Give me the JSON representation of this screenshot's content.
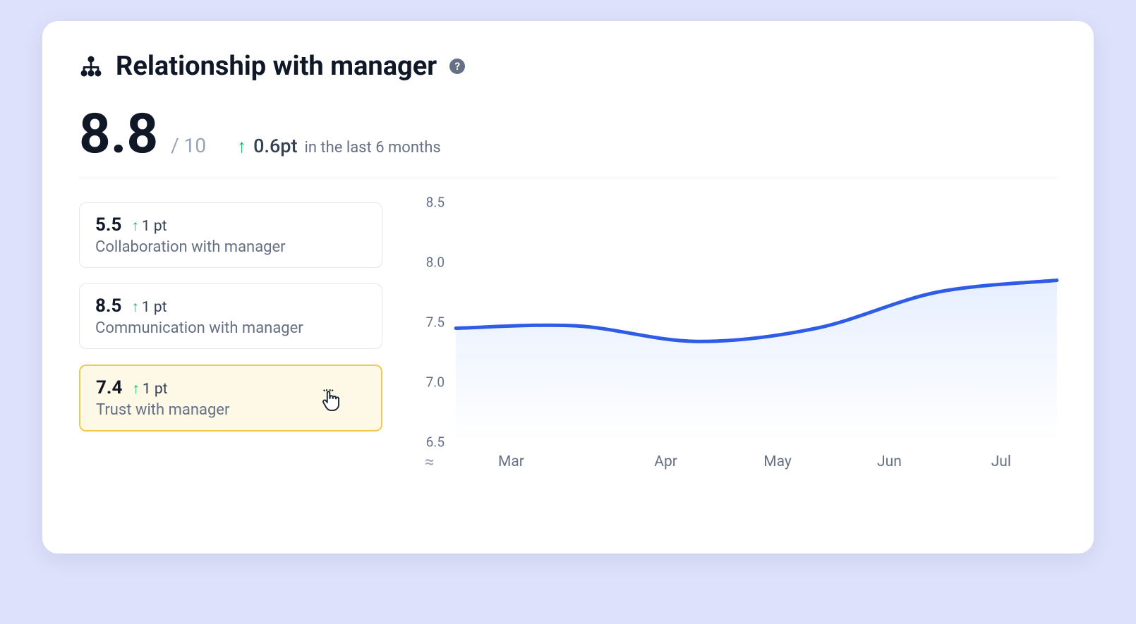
{
  "header": {
    "title": "Relationship with manager",
    "help_glyph": "?"
  },
  "summary": {
    "score": "8.8",
    "max": "/ 10",
    "delta_arrow": "↑",
    "delta_value": "0.6pt",
    "delta_period": "in the last 6 months"
  },
  "metrics": [
    {
      "score": "5.5",
      "delta": "1 pt",
      "label": "Collaboration with manager",
      "selected": false
    },
    {
      "score": "8.5",
      "delta": "1 pt",
      "label": "Communication with manager",
      "selected": false
    },
    {
      "score": "7.4",
      "delta": "1 pt",
      "label": "Trust with manager",
      "selected": true
    }
  ],
  "chart_data": {
    "type": "line",
    "title": "",
    "xlabel": "",
    "ylabel": "",
    "ylim": [
      6.5,
      8.5
    ],
    "y_ticks": [
      "8.5",
      "8.0",
      "7.5",
      "7.0",
      "6.5"
    ],
    "x_ticks": [
      "Mar",
      "Apr",
      "May",
      "Jun",
      "Jul"
    ],
    "x": [
      0,
      1,
      2,
      3,
      4,
      5
    ],
    "values": [
      7.45,
      7.47,
      7.34,
      7.45,
      7.75,
      7.85
    ],
    "series_name": "Trust with manager",
    "line_color": "#2e5ce6",
    "fill_top": "#e7efff",
    "fill_bottom": "#ffffff"
  },
  "axis_break_glyph": "≈"
}
